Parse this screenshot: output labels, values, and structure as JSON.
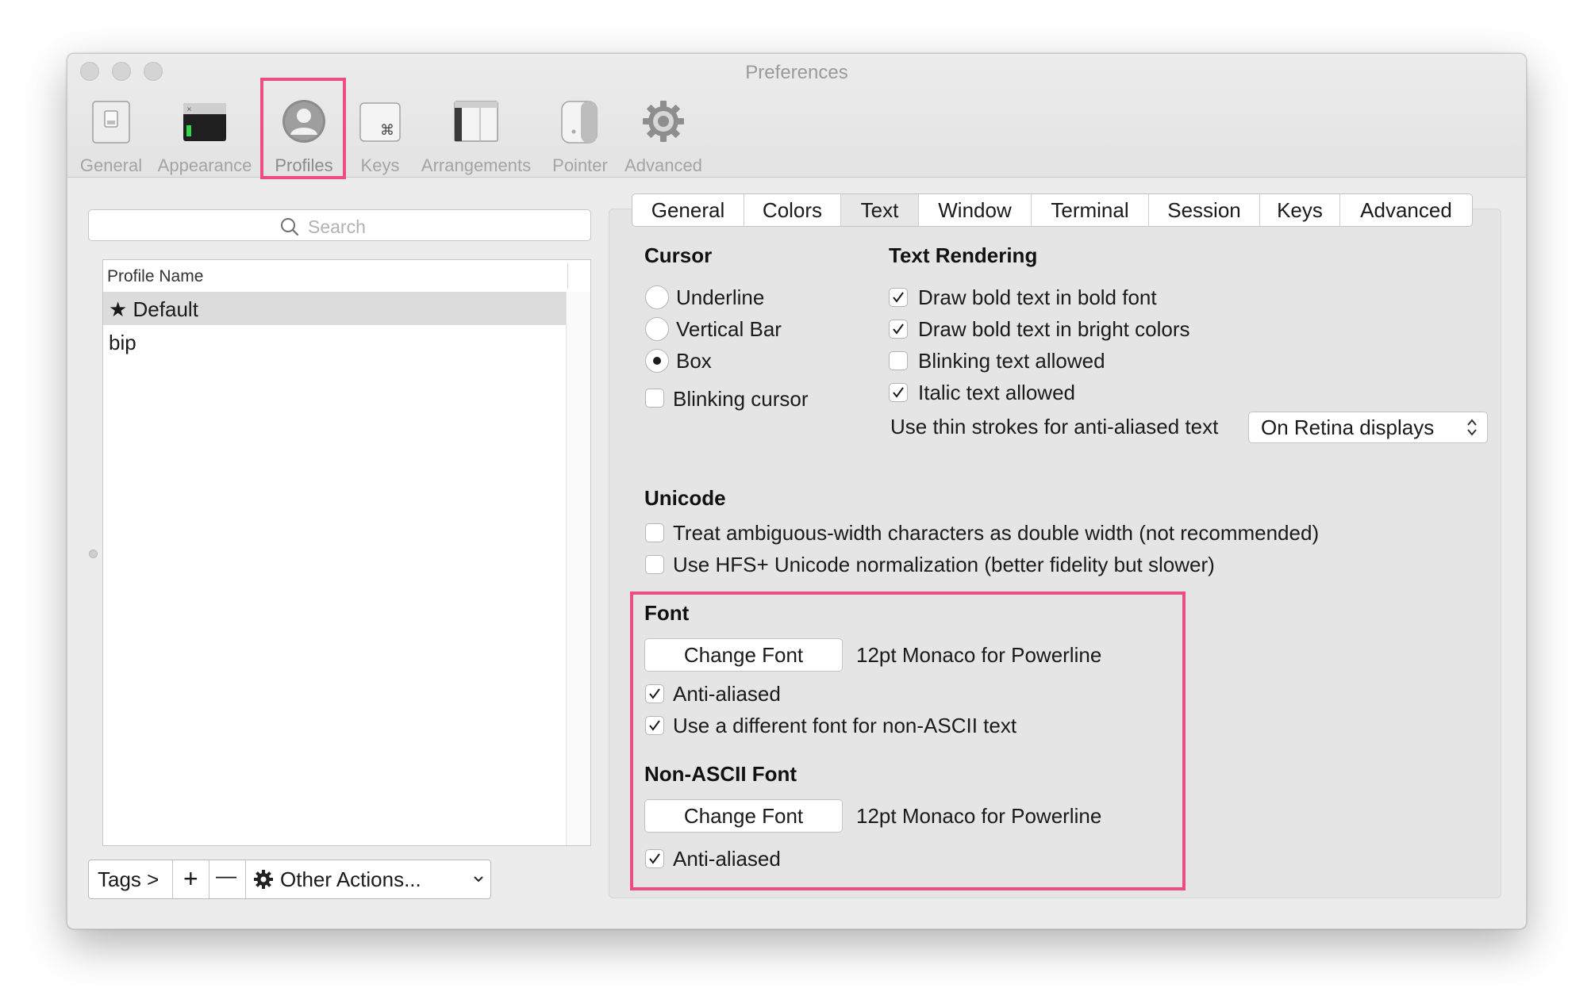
{
  "window": {
    "title": "Preferences"
  },
  "toolbar": {
    "items": [
      {
        "label": "General",
        "icon": "general-switch-icon"
      },
      {
        "label": "Appearance",
        "icon": "terminal-window-icon"
      },
      {
        "label": "Profiles",
        "icon": "user-silhouette-icon",
        "selected": true
      },
      {
        "label": "Keys",
        "icon": "command-key-icon"
      },
      {
        "label": "Arrangements",
        "icon": "window-arrangement-icon"
      },
      {
        "label": "Pointer",
        "icon": "mouse-icon"
      },
      {
        "label": "Advanced",
        "icon": "gear-icon"
      }
    ]
  },
  "sidebar": {
    "search_placeholder": "Search",
    "column_header": "Profile Name",
    "profiles": [
      {
        "name": "★ Default",
        "selected": true
      },
      {
        "name": "bip",
        "selected": false
      }
    ],
    "bottom_bar": {
      "tags_label": "Tags >",
      "add_label": "+",
      "remove_label": "—",
      "other_actions_label": "Other Actions..."
    }
  },
  "tabs": [
    {
      "label": "General"
    },
    {
      "label": "Colors"
    },
    {
      "label": "Text",
      "active": true
    },
    {
      "label": "Window"
    },
    {
      "label": "Terminal"
    },
    {
      "label": "Session"
    },
    {
      "label": "Keys"
    },
    {
      "label": "Advanced"
    }
  ],
  "cursor": {
    "title": "Cursor",
    "options": [
      {
        "label": "Underline",
        "selected": false
      },
      {
        "label": "Vertical Bar",
        "selected": false
      },
      {
        "label": "Box",
        "selected": true
      }
    ],
    "blinking": {
      "label": "Blinking cursor",
      "checked": false
    }
  },
  "text_rendering": {
    "title": "Text Rendering",
    "options": [
      {
        "label": "Draw bold text in bold font",
        "checked": true
      },
      {
        "label": "Draw bold text in bright colors",
        "checked": true
      },
      {
        "label": "Blinking text allowed",
        "checked": false
      },
      {
        "label": "Italic text allowed",
        "checked": true
      }
    ],
    "thin_strokes_label": "Use thin strokes for anti-aliased text",
    "thin_strokes_value": "On Retina displays"
  },
  "unicode": {
    "title": "Unicode",
    "options": [
      {
        "label": "Treat ambiguous-width characters as double width (not recommended)",
        "checked": false
      },
      {
        "label": "Use HFS+ Unicode normalization (better fidelity but slower)",
        "checked": false
      }
    ]
  },
  "font": {
    "title": "Font",
    "change_button": "Change Font",
    "value": "12pt Monaco for Powerline",
    "options": [
      {
        "label": "Anti-aliased",
        "checked": true
      },
      {
        "label": "Use a different font for non-ASCII text",
        "checked": true
      }
    ]
  },
  "non_ascii_font": {
    "title": "Non-ASCII Font",
    "change_button": "Change Font",
    "value": "12pt Monaco for Powerline",
    "options": [
      {
        "label": "Anti-aliased",
        "checked": true
      }
    ]
  },
  "colors": {
    "highlight": "#ee4d84",
    "window_bg": "#ececec",
    "selection": "#dcdcdc"
  }
}
